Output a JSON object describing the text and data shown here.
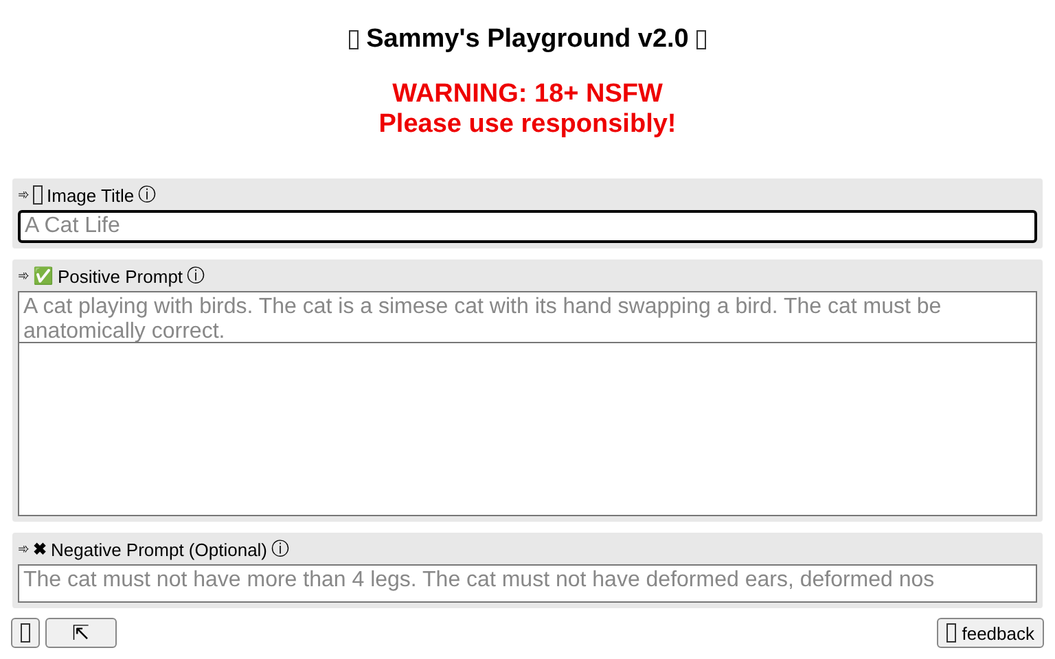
{
  "header": {
    "title": "Sammy's Playground v2.0",
    "warning": [
      "WARNING: 18+ NSFW",
      "Please use responsibly!"
    ]
  },
  "fields": [
    {
      "kind": "input",
      "prefix": "➾",
      "label": "Image Title",
      "info": "ⓘ",
      "placeholder": "A Cat Life",
      "focused": true
    },
    {
      "kind": "textarea",
      "prefix": "➾",
      "mark": "✅",
      "label": "Positive Prompt",
      "info": "ⓘ",
      "placeholder": "A cat playing with birds. The cat is a simese cat with its hand swapping a bird. The cat must be anatomically correct.",
      "focused": false
    },
    {
      "kind": "textarea",
      "prefix": "➾",
      "mark": "✖",
      "label": "Negative Prompt (Optional)",
      "info": "ⓘ",
      "placeholder": "The cat must not have more than 4 legs. The cat must not have deformed ears, deformed nos",
      "focused": false
    }
  ],
  "floating": {
    "scroll_top": "⇱",
    "feedback": "feedback"
  }
}
